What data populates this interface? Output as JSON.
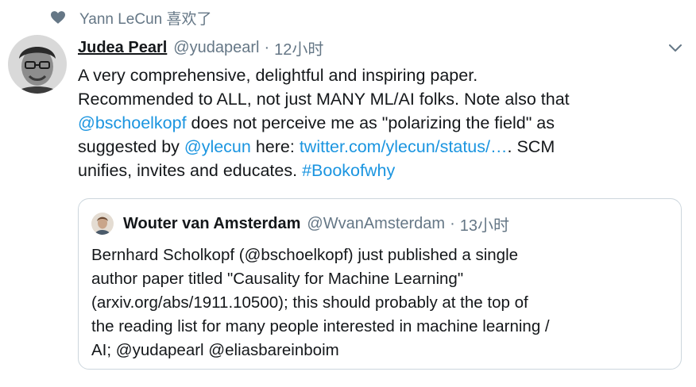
{
  "social_context": {
    "icon": "heart-icon",
    "text": "Yann LeCun 喜欢了"
  },
  "tweet": {
    "author_name": "Judea Pearl",
    "handle": "@yudapearl",
    "separator": "·",
    "time": "12小时",
    "caret_icon": "chevron-down-icon",
    "lines": {
      "l1": "A very comprehensive, delightful and inspiring paper.",
      "l2": "Recommended to ALL, not just MANY ML/AI folks. Note also that",
      "l3_mention": "@bschoelkopf",
      "l3_rest": " does not perceive me as \"polarizing the field\" as",
      "l4_pre": "suggested by ",
      "l4_mention": "@ylecun",
      "l4_mid": " here: ",
      "l4_link": "twitter.com/ylecun/status/…",
      "l4_post": ". SCM",
      "l5_pre": "unifies, invites and educates. ",
      "l5_hashtag": "#Bookofwhy"
    }
  },
  "quoted": {
    "author_name": "Wouter van Amsterdam",
    "handle": "@WvanAmsterdam",
    "separator": "·",
    "time": "13小时",
    "lines": {
      "l1": "Bernhard Scholkopf (@bschoelkopf) just published a single",
      "l2": "author paper titled \"Causality for Machine Learning\"",
      "l3": "(arxiv.org/abs/1911.10500); this should probably at the top of",
      "l4": "the reading list for many people interested in machine learning /",
      "l5": "AI; @yudapearl @eliasbareinboim"
    }
  },
  "colors": {
    "link": "#1b95e0",
    "secondary_text": "#657786",
    "primary_text": "#14171a",
    "border": "#ccd6dd"
  }
}
